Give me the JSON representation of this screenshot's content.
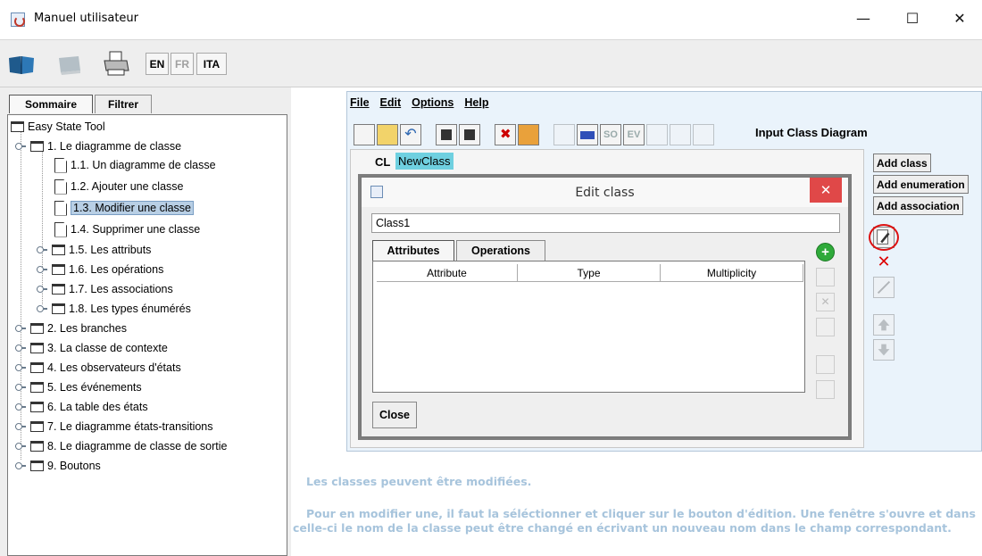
{
  "window": {
    "title": "Manuel utilisateur",
    "minimize": "—",
    "maximize": "☐",
    "close": "✕"
  },
  "toolbar": {
    "lang_en": "EN",
    "lang_fr": "FR",
    "lang_ita": "ITA"
  },
  "left_tabs": {
    "sommaire": "Sommaire",
    "filtrer": "Filtrer"
  },
  "tree": {
    "root": "Easy State Tool",
    "items": [
      "1. Le diagramme de classe",
      "1.1. Un diagramme de classe",
      "1.2. Ajouter une classe",
      "1.3. Modifier une classe",
      "1.4. Supprimer une classe",
      "1.5. Les attributs",
      "1.6. Les opérations",
      "1.7. Les associations",
      "1.8. Les types énumérés",
      "2. Les branches",
      "3. La classe de contexte",
      "4. Les observateurs d'états",
      "5. Les événements",
      "6. La table des états",
      "7. Le diagramme états-transitions",
      "8. Le diagramme de classe de sortie",
      "9. Boutons"
    ],
    "selected": "1.3. Modifier une classe"
  },
  "app": {
    "menu": {
      "file": "File",
      "edit": "Edit",
      "options": "Options",
      "help": "Help"
    },
    "toolbar_title": "Input Class Diagram",
    "tool_text": {
      "so": "SO",
      "ev": "EV"
    },
    "node_prefix": "CL",
    "node_name": "NewClass",
    "buttons": {
      "add_class": "Add class",
      "add_enumeration": "Add enumeration",
      "add_association": "Add association"
    }
  },
  "dialog": {
    "title": "Edit class",
    "close_x": "✕",
    "class_name_value": "Class1",
    "tabs": {
      "attributes": "Attributes",
      "operations": "Operations"
    },
    "columns": [
      "Attribute",
      "Type",
      "Multiplicity"
    ],
    "add_icon": "+",
    "delete_icon": "✕",
    "close_button": "Close"
  },
  "description": {
    "line1": "Les classes peuvent être modifiées.",
    "line2": "Pour en modifier une, il faut la séléctionner et cliquer sur le bouton d'édition. Une fenêtre s'ouvre et dans celle-ci le nom de la classe peut être changé en écrivant un nouveau nom dans le champ correspondant."
  },
  "icons": [
    "app-icon",
    "book-open-icon",
    "book-closed-icon",
    "printer-icon",
    "folder-icon",
    "page-icon",
    "edit-class-icon",
    "delete-class-icon",
    "add-attribute-icon"
  ],
  "colors": {
    "selection": "#b8cfe5",
    "node_highlight": "#6fd0e0",
    "dialog_close": "#e04848",
    "description_text": "#a7c4dc",
    "highlight_circle": "#d11111"
  }
}
